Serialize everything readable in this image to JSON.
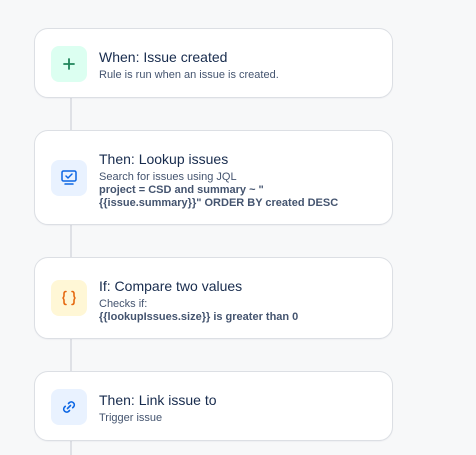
{
  "rules": [
    {
      "title": "When: Issue created",
      "subtitle": "Rule is run when an issue is created.",
      "icon": "plus-icon",
      "color": "#1f845a",
      "tile_color": "#dcfff1"
    },
    {
      "title": "Then: Lookup issues",
      "subtitle": "Search for issues using JQL",
      "detail": "project = CSD and summary ~ \"\n{{issue.summary}}\" ORDER BY created DESC",
      "icon": "monitor-check-icon",
      "color": "#0c66e4",
      "tile_color": "#e9f2ff"
    },
    {
      "title": "If: Compare two values",
      "subtitle": "Checks if:",
      "detail": "{{lookupIssues.size}} is greater than 0",
      "icon": "curly-braces-icon",
      "color": "#e56910",
      "tile_color": "#fff7d6"
    },
    {
      "title": "Then: Link issue to",
      "subtitle": "Trigger issue",
      "icon": "link-icon",
      "color": "#0c66e4",
      "tile_color": "#e9f2ff"
    }
  ]
}
